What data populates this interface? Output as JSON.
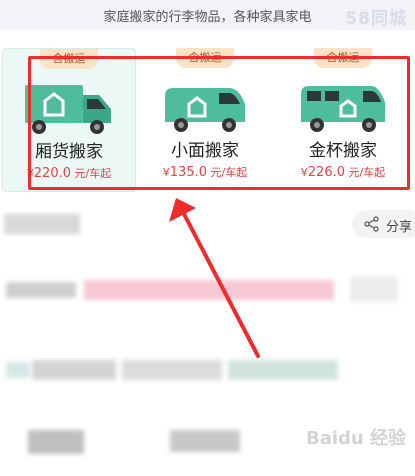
{
  "banner": {
    "text": "家庭搬家的行李物品，各种家具家电",
    "logo": "58同城"
  },
  "vehicles": [
    {
      "tag": "含搬运",
      "name": "厢货搬家",
      "price_prefix": "¥",
      "price": "220.0",
      "unit": "元/车起"
    },
    {
      "tag": "含搬运",
      "name": "小面搬家",
      "price_prefix": "¥",
      "price": "135.0",
      "unit": "元/车起"
    },
    {
      "tag": "含搬运",
      "name": "金杯搬家",
      "price_prefix": "¥",
      "price": "226.0",
      "unit": "元/车起"
    }
  ],
  "share": {
    "label": "分享"
  },
  "watermark": {
    "text": "Baidu 经验"
  },
  "colors": {
    "accent": "#4dbd9c",
    "price": "#e74141",
    "highlight": "#ef2b2b"
  }
}
